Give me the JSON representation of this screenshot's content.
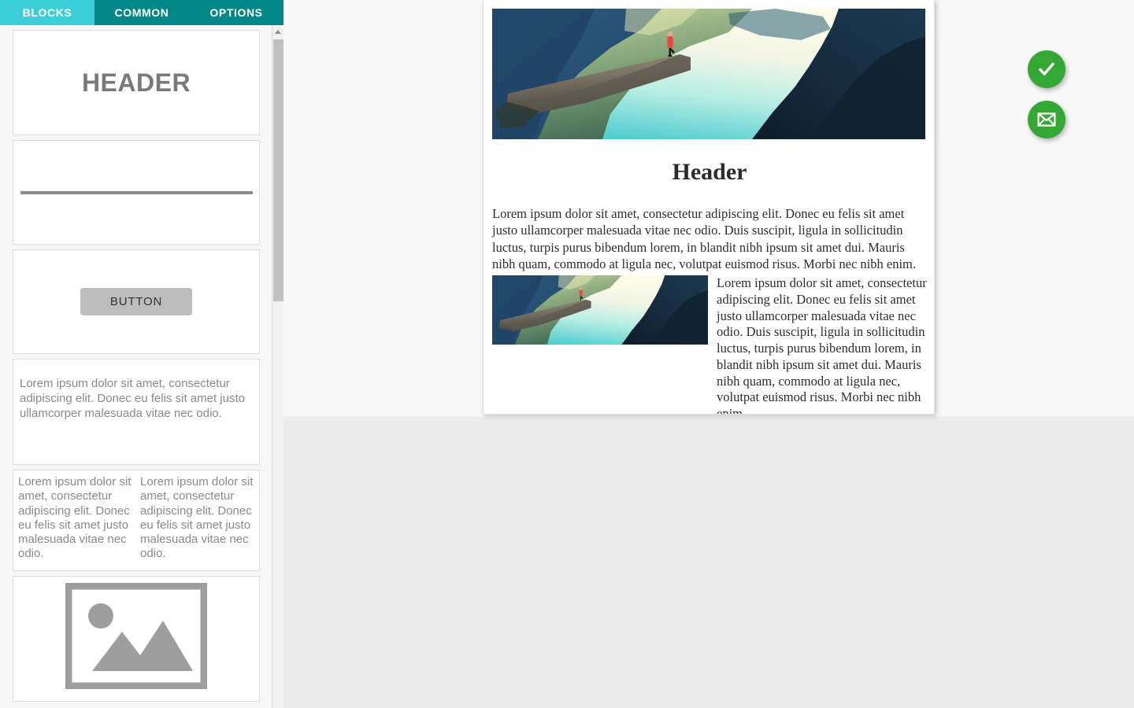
{
  "tabs": [
    {
      "id": "blocks",
      "label": "BLOCKS",
      "active": true
    },
    {
      "id": "common",
      "label": "COMMON",
      "active": false
    },
    {
      "id": "options",
      "label": "OPTIONS",
      "active": false
    }
  ],
  "palette": {
    "blocks": [
      {
        "id": "header",
        "type": "header",
        "label": "HEADER"
      },
      {
        "id": "divider",
        "type": "divider",
        "label": ""
      },
      {
        "id": "button",
        "type": "button",
        "label": "BUTTON"
      },
      {
        "id": "text",
        "type": "text",
        "label": "Lorem ipsum dolor sit amet, consectetur adipiscing elit. Donec eu felis sit amet justo ullamcorper malesuada vitae nec odio."
      },
      {
        "id": "twocol",
        "type": "two-column",
        "col_left": "Lorem ipsum dolor sit amet, consectetur adipiscing elit. Donec eu felis sit amet justo malesuada vitae nec odio.",
        "col_right": "Lorem ipsum dolor sit amet, consectetur adipiscing elit. Donec eu felis sit amet justo malesuada vitae nec odio."
      },
      {
        "id": "image",
        "type": "image",
        "label": ""
      }
    ]
  },
  "scrollbar": {
    "up_arrow_icon": "caret-up-icon",
    "thumb_position_percent": 0
  },
  "canvas": {
    "hero_image_alt": "cliff-overlooking-fjord-photo",
    "header": "Header",
    "paragraph": "Lorem ipsum dolor sit amet, consectetur adipiscing elit. Donec eu felis sit amet justo ullamcorper malesuada vitae nec odio. Duis suscipit, ligula in sollicitudin luctus, turpis purus bibendum lorem, in blandit nibh ipsum sit amet dui. Mauris nibh quam, commodo at ligula nec, volutpat euismod risus. Morbi nec nibh enim.",
    "media_block": {
      "thumbnail_alt": "cliff-overlooking-fjord-thumbnail",
      "text": "Lorem ipsum dolor sit amet, consectetur adipiscing elit. Donec eu felis sit amet justo ullamcorper malesuada vitae nec odio. Duis suscipit, ligula in sollicitudin luctus, turpis purus bibendum lorem, in blandit nibh ipsum sit amet dui. Mauris nibh quam, commodo at ligula nec, volutpat euismod risus. Morbi nec nibh enim."
    }
  },
  "actions": [
    {
      "id": "confirm",
      "icon": "check-icon",
      "color": "#35a735"
    },
    {
      "id": "mail",
      "icon": "envelope-icon",
      "color": "#35a735"
    }
  ],
  "colors": {
    "tab_active": "#3ccfd9",
    "tab_inactive": "#018786",
    "fab_green": "#35a735",
    "panel_bg": "#f7f7f7",
    "canvas_bg_top": "#f8f8f8",
    "canvas_bg_bottom": "#ececec",
    "placeholder_gray": "#9e9e9e"
  }
}
